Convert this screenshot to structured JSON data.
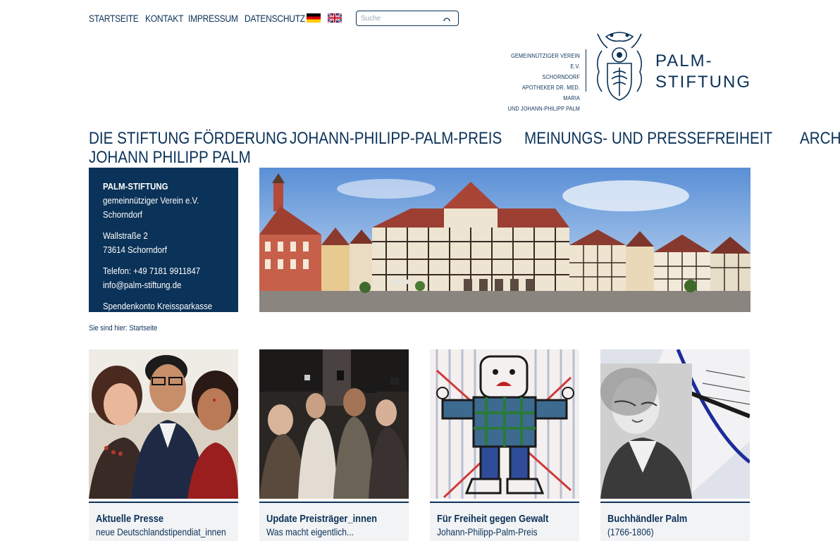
{
  "topnav": {
    "items": [
      "STARTSEITE",
      "KONTAKT",
      "IMPRESSUM",
      "DATENSCHUTZ"
    ]
  },
  "languages": [
    {
      "name": "german-flag-icon"
    },
    {
      "name": "uk-flag-icon"
    }
  ],
  "search": {
    "placeholder": "Suche",
    "icon": "search-icon"
  },
  "logo": {
    "text_lines": [
      "GEMEINNÜTZIGER VEREIN E.V.",
      "SCHORNDORF",
      "APOTHEKER DR. MED. MARIA",
      "UND JOHANN-PHILIPP PALM"
    ],
    "name_line1": "PALM-",
    "name_line2": "STIFTUNG",
    "icon": "crest-icon"
  },
  "mainnav": {
    "items": [
      "DIE STIFTUNG",
      "FÖRDERUNG",
      "JOHANN-PHILIPP-PALM-PREIS",
      "MEINUNGS- UND PRESSEFREIHEIT",
      "ARCHIV"
    ],
    "second_row": "JOHANN PHILIPP PALM"
  },
  "info": {
    "name": "PALM-STIFTUNG",
    "line1": "gemeinnütziger Verein e.V.",
    "line2": "Schorndorf",
    "street": "Wallstraße 2",
    "city": "73614 Schorndorf",
    "phone": "Telefon: +49 7181 9911847",
    "email": "info@palm-stiftung.de",
    "bank": "Spendenkonto Kreissparkasse"
  },
  "breadcrumb": {
    "prefix": "Sie sind hier:",
    "current": "Startseite"
  },
  "cards": [
    {
      "title": "Aktuelle Presse",
      "subtitle": "neue Deutschlandstipendiat_innen"
    },
    {
      "title": "Update Preisträger_innen",
      "subtitle": "Was macht eigentlich..."
    },
    {
      "title": "Für Freiheit gegen Gewalt",
      "subtitle": "Johann-Philipp-Palm-Preis"
    },
    {
      "title": "Buchhändler Palm",
      "subtitle": "(1766-1806)"
    }
  ],
  "colors": {
    "brand": "#0b3258",
    "card_bg": "#f2f3f5"
  }
}
